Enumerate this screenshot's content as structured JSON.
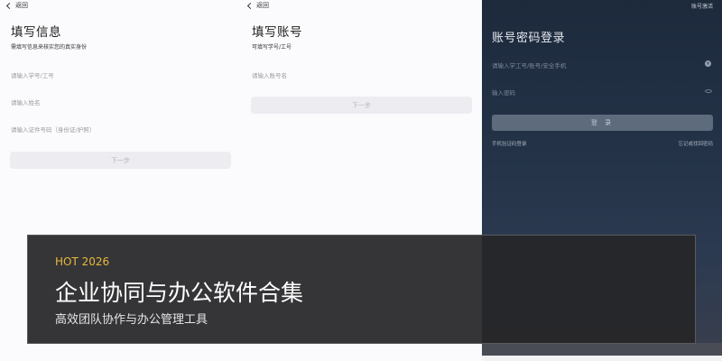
{
  "panel1": {
    "back_label": "返回",
    "title": "填写信息",
    "subtitle": "需填写信息来核实您的真实身份",
    "fields": [
      {
        "placeholder": "请输入学号/工号"
      },
      {
        "placeholder": "请输入姓名"
      },
      {
        "placeholder": "请输入证件号码（身份证/护照）"
      }
    ],
    "next_label": "下一步"
  },
  "panel2": {
    "back_label": "返回",
    "title": "填写账号",
    "subtitle": "可填写学号/工号",
    "fields": [
      {
        "placeholder": "请输入账号名"
      }
    ],
    "next_label": "下一步"
  },
  "panel3": {
    "top_right": "账号激活",
    "title": "账号密码登录",
    "account_placeholder": "请输入学工号/账号/安全手机",
    "password_placeholder": "输入密码",
    "login_label": "登 录",
    "link_left": "手机验证码登录",
    "link_right": "忘记或找回密码"
  },
  "banner": {
    "tag": "HOT 2026",
    "headline": "企业协同与办公软件合集",
    "sub": "高效团队协作与办公管理工具"
  }
}
